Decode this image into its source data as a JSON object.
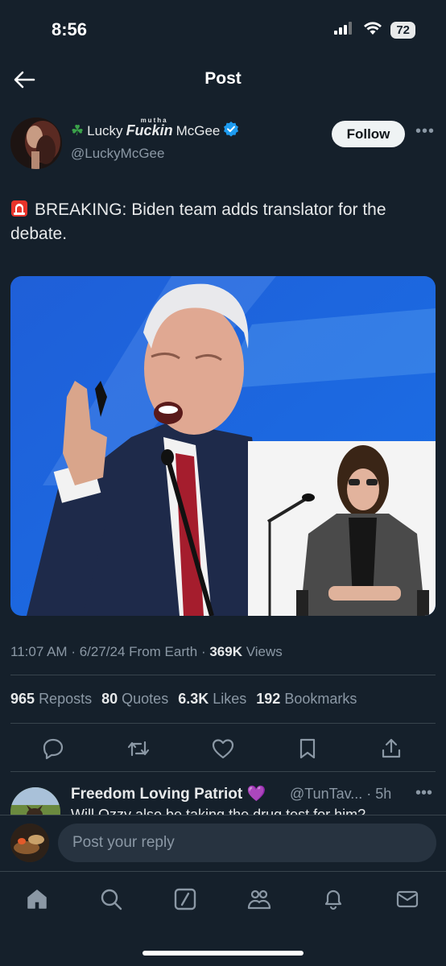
{
  "status_bar": {
    "time": "8:56",
    "battery": "72"
  },
  "header": {
    "title": "Post"
  },
  "author": {
    "display_name_prefix": "Lucky",
    "display_name_bold": "Fuckin",
    "display_name_sup": "mutha",
    "display_name_suffix": "McGee",
    "handle": "@LuckyMcGee",
    "follow_label": "Follow"
  },
  "tweet": {
    "text": "BREAKING: Biden team adds translator for the debate."
  },
  "meta": {
    "time": "11:07 AM",
    "date": "6/27/24",
    "source": "From Earth",
    "views_count": "369K",
    "views_label": "Views"
  },
  "stats": [
    {
      "count": "965",
      "label": "Reposts"
    },
    {
      "count": "80",
      "label": "Quotes"
    },
    {
      "count": "6.3K",
      "label": "Likes"
    },
    {
      "count": "192",
      "label": "Bookmarks"
    }
  ],
  "reply": {
    "name": "Freedom Loving Patriot 💜",
    "handle": "@TunTav... · 5h",
    "snippet": "Will Ozzy also be taking the drug test for him?"
  },
  "composer": {
    "placeholder": "Post your reply"
  },
  "colors": {
    "background": "#15202b",
    "accent": "#1d9bf0",
    "muted": "#8b98a5",
    "text": "#e7e9ea"
  }
}
